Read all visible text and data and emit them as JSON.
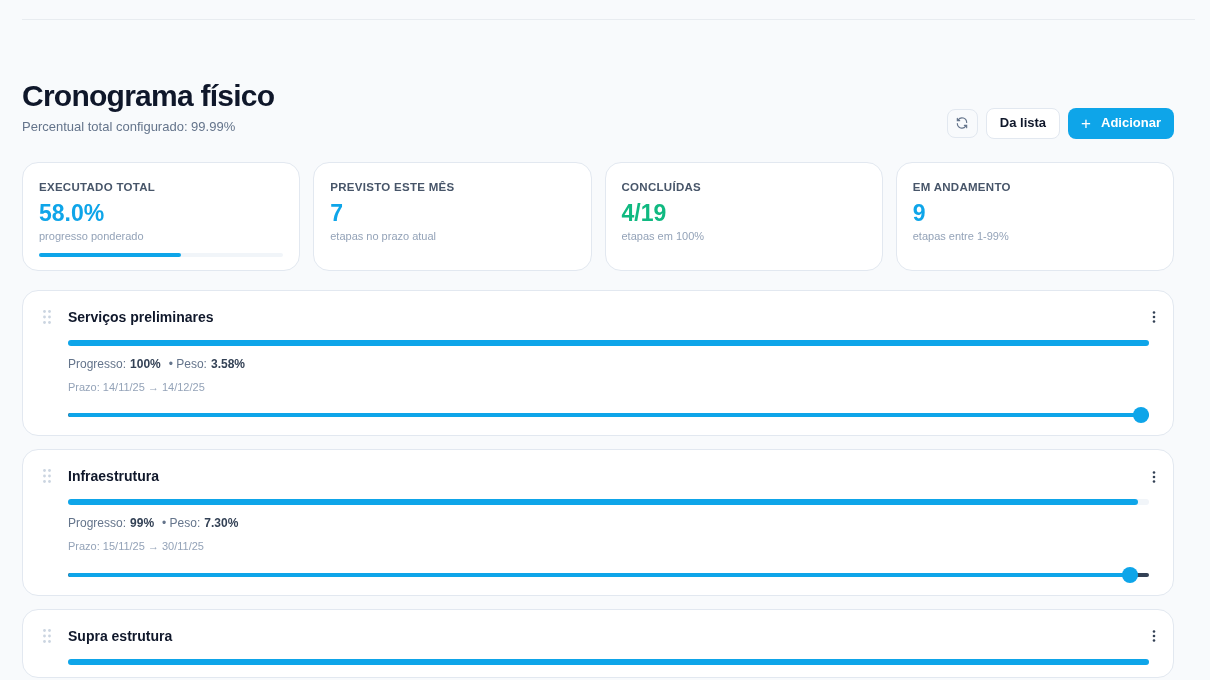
{
  "page": {
    "title": "Cronograma físico",
    "subtitle": "Percentual total configurado: 99.99%"
  },
  "actions": [
    {
      "kind": "icon"
    },
    {
      "kind": "outline",
      "label": "Da lista"
    },
    {
      "kind": "primary",
      "label": "Adicionar",
      "icon": "+"
    }
  ],
  "stats": [
    {
      "label": "EXECUTADO TOTAL",
      "value": "58.0%",
      "caption": "progresso ponderado",
      "color": "#0ea5e9",
      "level": 0.58
    },
    {
      "label": "PREVISTO ESTE MÊS",
      "value": "7",
      "caption": "etapas no prazo atual",
      "color": "#0ea5e9"
    },
    {
      "label": "CONCLUÍDAS",
      "value": "4/19",
      "caption": "etapas em 100%",
      "color": "#10b981"
    },
    {
      "label": "EM ANDAMENTO",
      "value": "9",
      "caption": "etapas entre 1-99%",
      "color": "#0ea5e9"
    }
  ],
  "stages": [
    {
      "name": "Serviços preliminares",
      "level": 1,
      "progress_label": "Progresso:",
      "progress": "100%",
      "weight_label": "• Peso:",
      "weight": "3.58%",
      "deadline": "Prazo: 14/11/25 → 14/12/25",
      "slider": {
        "level": 1
      }
    },
    {
      "name": "Infraestrutura",
      "level": 0.99,
      "progress_label": "Progresso:",
      "progress": "99%",
      "weight_label": "• Peso:",
      "weight": "7.30%",
      "deadline": "Prazo: 15/11/25 → 30/11/25",
      "slider": {
        "level": 0.99
      }
    },
    {
      "name": "Supra estrutura",
      "level": 1
    }
  ]
}
